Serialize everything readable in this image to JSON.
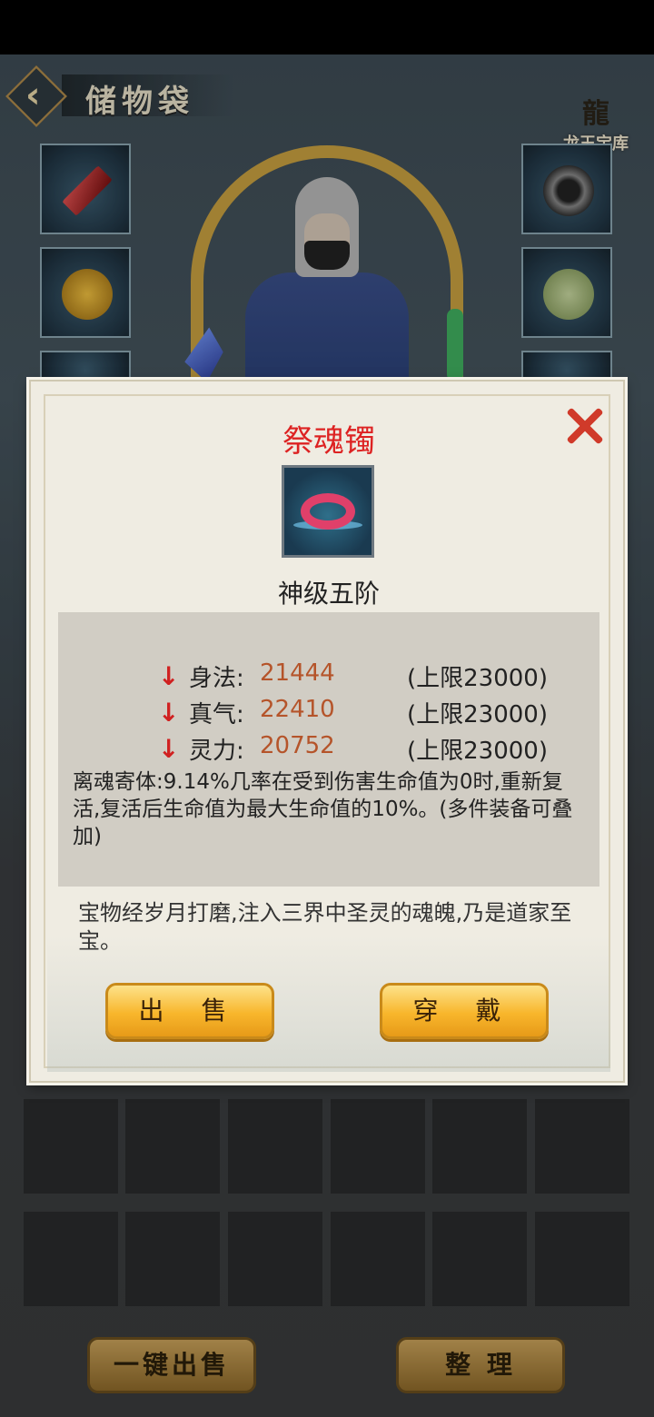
{
  "header": {
    "title": "储物袋",
    "logo_text": "龙王宝库"
  },
  "bottom_buttons": {
    "sell_all": "一键出售",
    "sort": "整 理"
  },
  "dialog": {
    "item_name": "祭魂镯",
    "grade": "神级五阶",
    "stats": [
      {
        "label": "身法:",
        "value": "21444",
        "limit": "(上限23000)"
      },
      {
        "label": "真气:",
        "value": "22410",
        "limit": "(上限23000)"
      },
      {
        "label": "灵力:",
        "value": "20752",
        "limit": "(上限23000)"
      }
    ],
    "effect": "离魂寄体:9.14%几率在受到伤害生命值为0时,重新复活,复活后生命值为最大生命值的10%。(多件装备可叠加)",
    "flavor": "宝物经岁月打磨,注入三界中圣灵的魂魄,乃是道家至宝。",
    "sell_button": "出 售",
    "equip_button": "穿 戴"
  },
  "colors": {
    "item_name": "#dd2222",
    "stat_value": "#b5542a",
    "arrow": "#d02020",
    "button_gold": "#f8b62c"
  }
}
